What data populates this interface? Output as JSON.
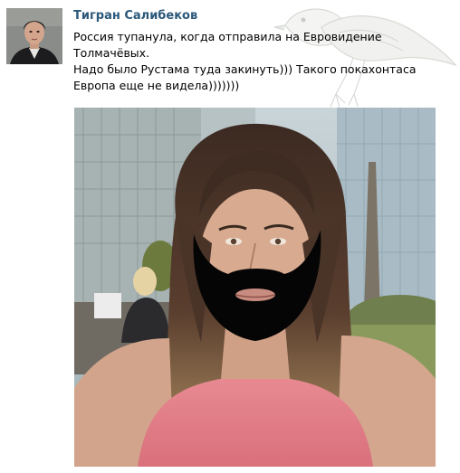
{
  "post": {
    "author": "Тигран Салибеков",
    "text_lines": [
      "Россия тупанула, когда отправила на Евровидение",
      "Толмачёвых.",
      "Надо было Рустама туда закинуть))) Такого покахонтаса",
      "Европа еще не видела)))))))"
    ]
  },
  "colors": {
    "author_link": "#2b587a",
    "text": "#000000",
    "background": "#ffffff"
  },
  "icons": {
    "watermark": "bird-watermark-icon"
  }
}
